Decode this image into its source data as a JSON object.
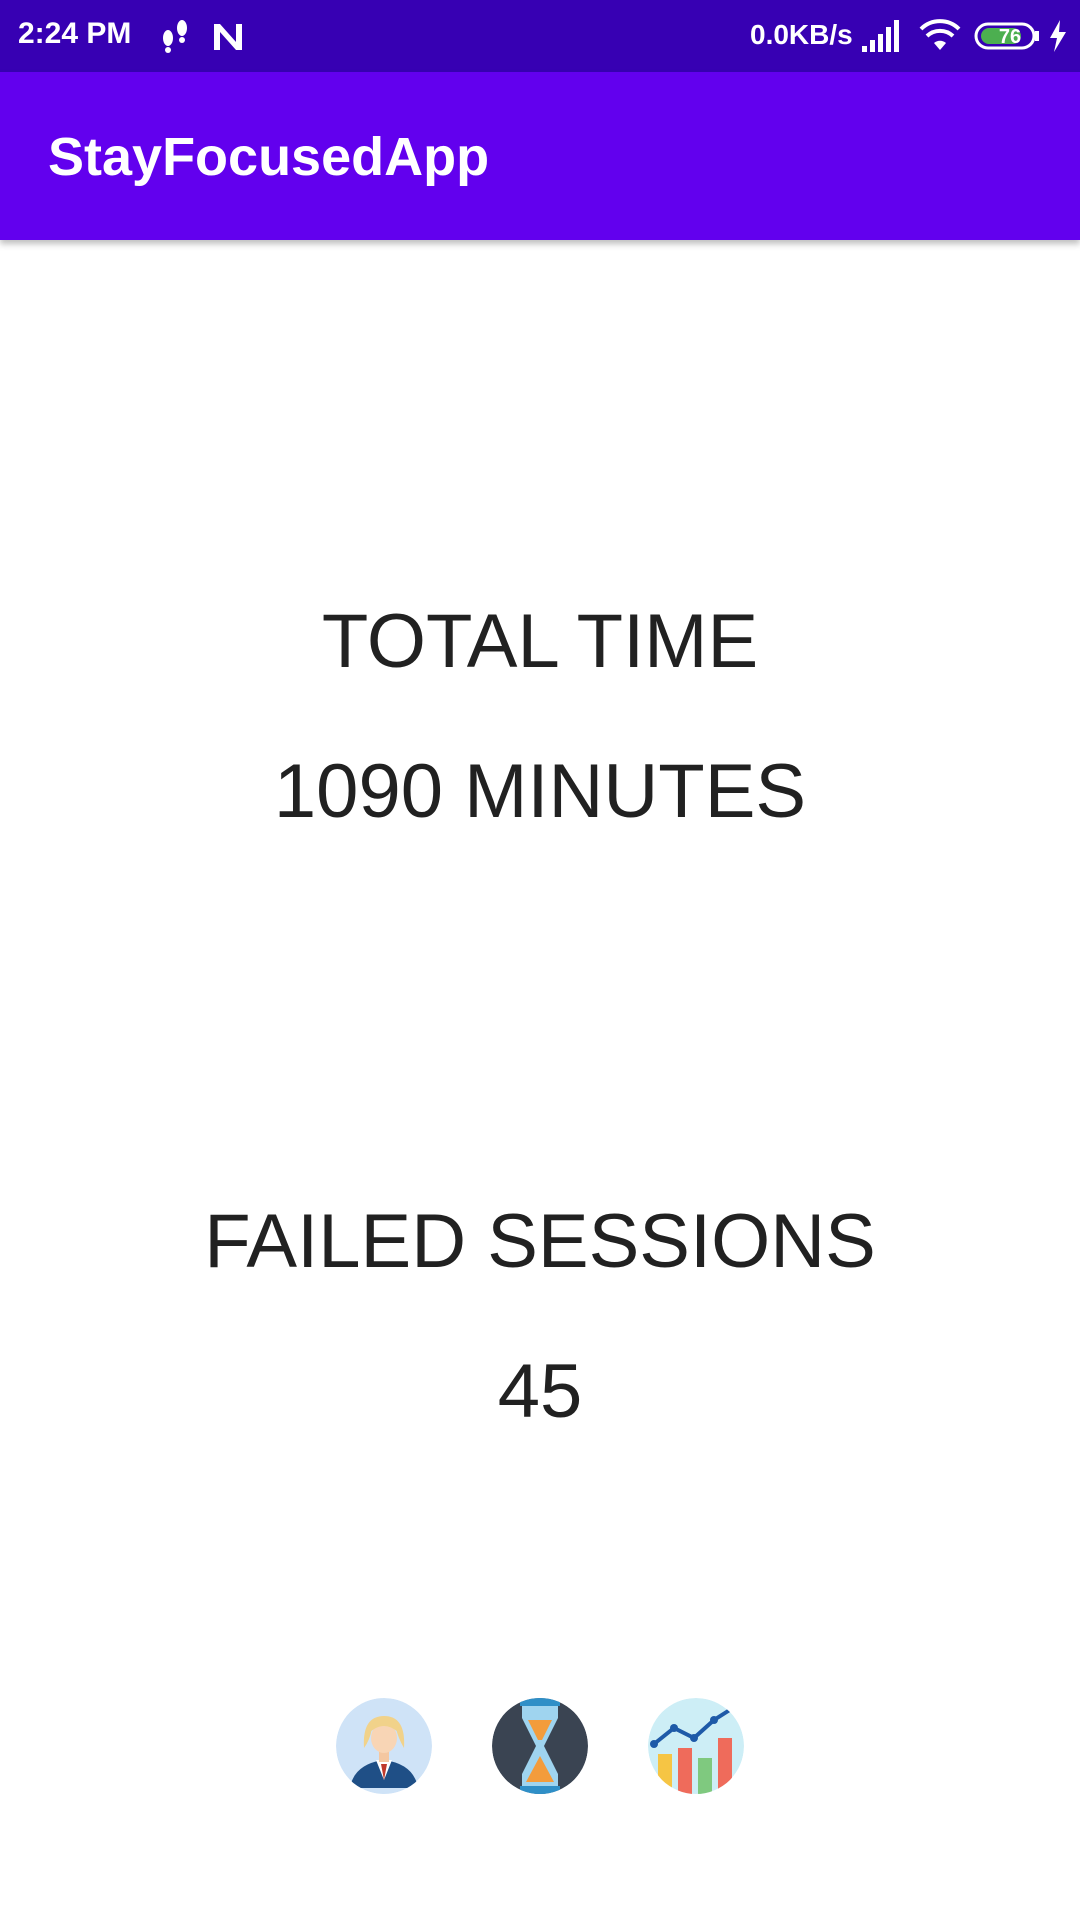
{
  "status_bar": {
    "time": "2:24 PM",
    "network_speed": "0.0KB/s",
    "battery_level": "76",
    "icons": [
      "steps-icon",
      "n-notification-icon",
      "signal-icon",
      "wifi-icon",
      "battery-icon",
      "charging-icon"
    ],
    "background_color": "#3700b3"
  },
  "app_bar": {
    "title": "StayFocusedApp",
    "background_color": "#6200ee"
  },
  "stats": {
    "total_time_label": "TOTAL TIME",
    "total_time_value": "1090 MINUTES",
    "failed_sessions_label": "FAILED SESSIONS",
    "failed_sessions_value": "45"
  },
  "bottom_nav": {
    "items": [
      {
        "icon": "profile-icon"
      },
      {
        "icon": "hourglass-timer-icon"
      },
      {
        "icon": "statistics-chart-icon"
      }
    ]
  }
}
